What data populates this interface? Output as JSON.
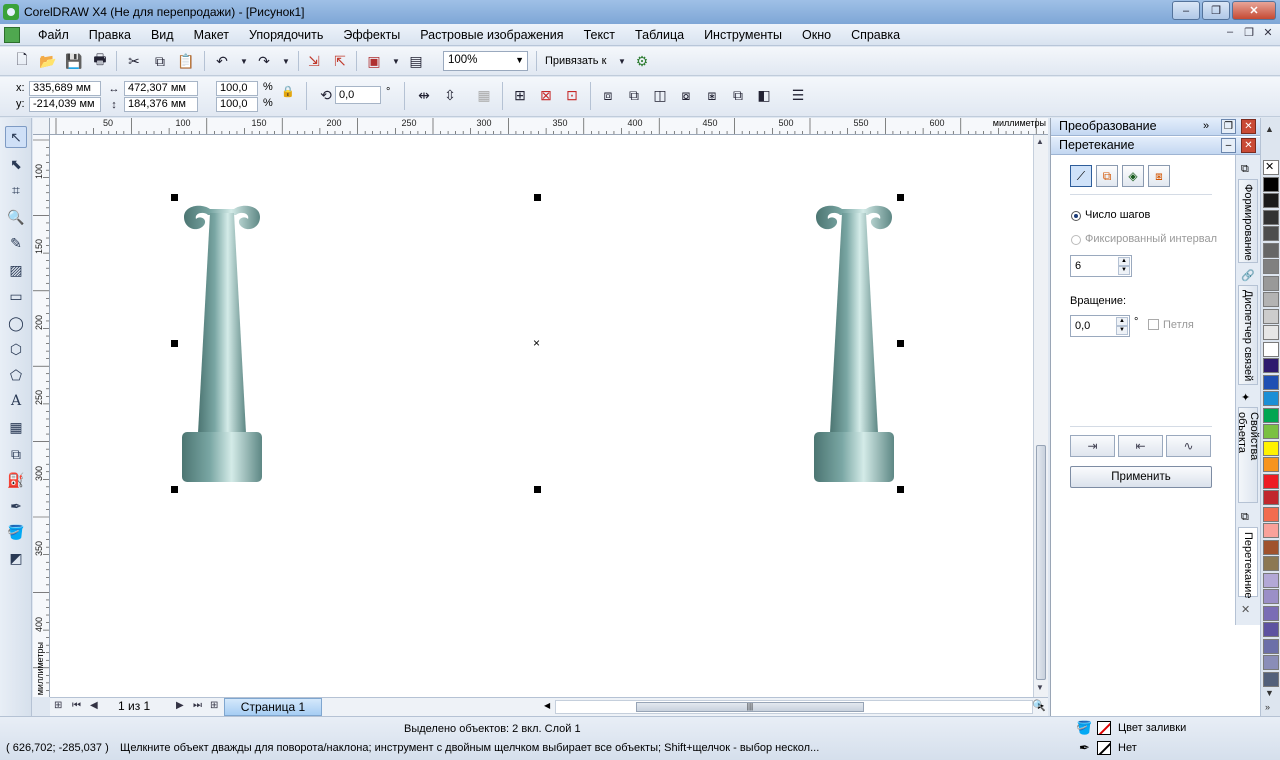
{
  "window": {
    "title": "CorelDRAW X4 (Не для перепродажи) - [Рисунок1]",
    "minimize": "–",
    "restore": "❐",
    "close": "✕"
  },
  "menu": [
    "Файл",
    "Правка",
    "Вид",
    "Макет",
    "Упорядочить",
    "Эффекты",
    "Растровые изображения",
    "Текст",
    "Таблица",
    "Инструменты",
    "Окно",
    "Справка"
  ],
  "toolbar": {
    "zoom": "100%",
    "snap_label": "Привязать к"
  },
  "property_bar": {
    "x_label": "x:",
    "x_value": "335,689 мм",
    "y_label": "y:",
    "y_value": "-214,039 мм",
    "width_value": "472,307 мм",
    "height_value": "184,376 мм",
    "scale_x": "100,0",
    "scale_y": "100,0",
    "percent": "%",
    "rotation": "0,0",
    "degree": "°"
  },
  "rulers": {
    "h_ticks": [
      "50",
      "100",
      "150",
      "200",
      "250",
      "300",
      "350",
      "400",
      "450",
      "500",
      "550",
      "600"
    ],
    "v_ticks": [
      "100",
      "150",
      "200",
      "250",
      "300",
      "350",
      "400"
    ],
    "units": "миллиметры"
  },
  "pagebar": {
    "counter": "1 из 1",
    "page_tab": "Страница 1",
    "scroll_grip": "|||"
  },
  "docker": {
    "header_transform": "Преобразование",
    "header_blend": "Перетекание",
    "steps_label": "Число шагов",
    "fixed_label": "Фиксированный интервал",
    "steps_value": "6",
    "rotation_label": "Вращение:",
    "rotation_value": "0,0",
    "degree": "°",
    "loop_label": "Петля",
    "apply_label": "Применить"
  },
  "docker_tabs": [
    "Формирование",
    "Диспетчер связей",
    "Свойства объекта",
    "Перетекание"
  ],
  "palette": [
    "#ffffff",
    "#000000",
    "#1a1a1a",
    "#333333",
    "#4d4d4d",
    "#666666",
    "#808080",
    "#999999",
    "#b3b3b3",
    "#cccccc",
    "#e6e6e6",
    "#ffffff",
    "#2e1a6e",
    "#1f4fb3",
    "#1a8fd6",
    "#00a651",
    "#7ac142",
    "#fff200",
    "#f7941d",
    "#ed1c24",
    "#c1272d",
    "#f26c4f",
    "#f9a19a",
    "#a0522d",
    "#8c7853",
    "#b3a8d6",
    "#9b8fc7",
    "#7a6db5",
    "#5d52a0",
    "#6c6fa8",
    "#8a8db8",
    "#53607a"
  ],
  "status": {
    "selected": "Выделено объектов: 2 вкл. Слой 1",
    "coords": "( 626,702; -285,037 )",
    "hint": "Щелкните объект дважды для поворота/наклона; инструмент с двойным щелчком выбирает все объекты; Shift+щелчок - выбор нескол...",
    "fill_label": "Цвет заливки",
    "outline_label": "Нет"
  },
  "colors": {
    "column_light": "#cfe6e3",
    "column_mid": "#7aa7a4",
    "column_dark": "#4c7572"
  }
}
